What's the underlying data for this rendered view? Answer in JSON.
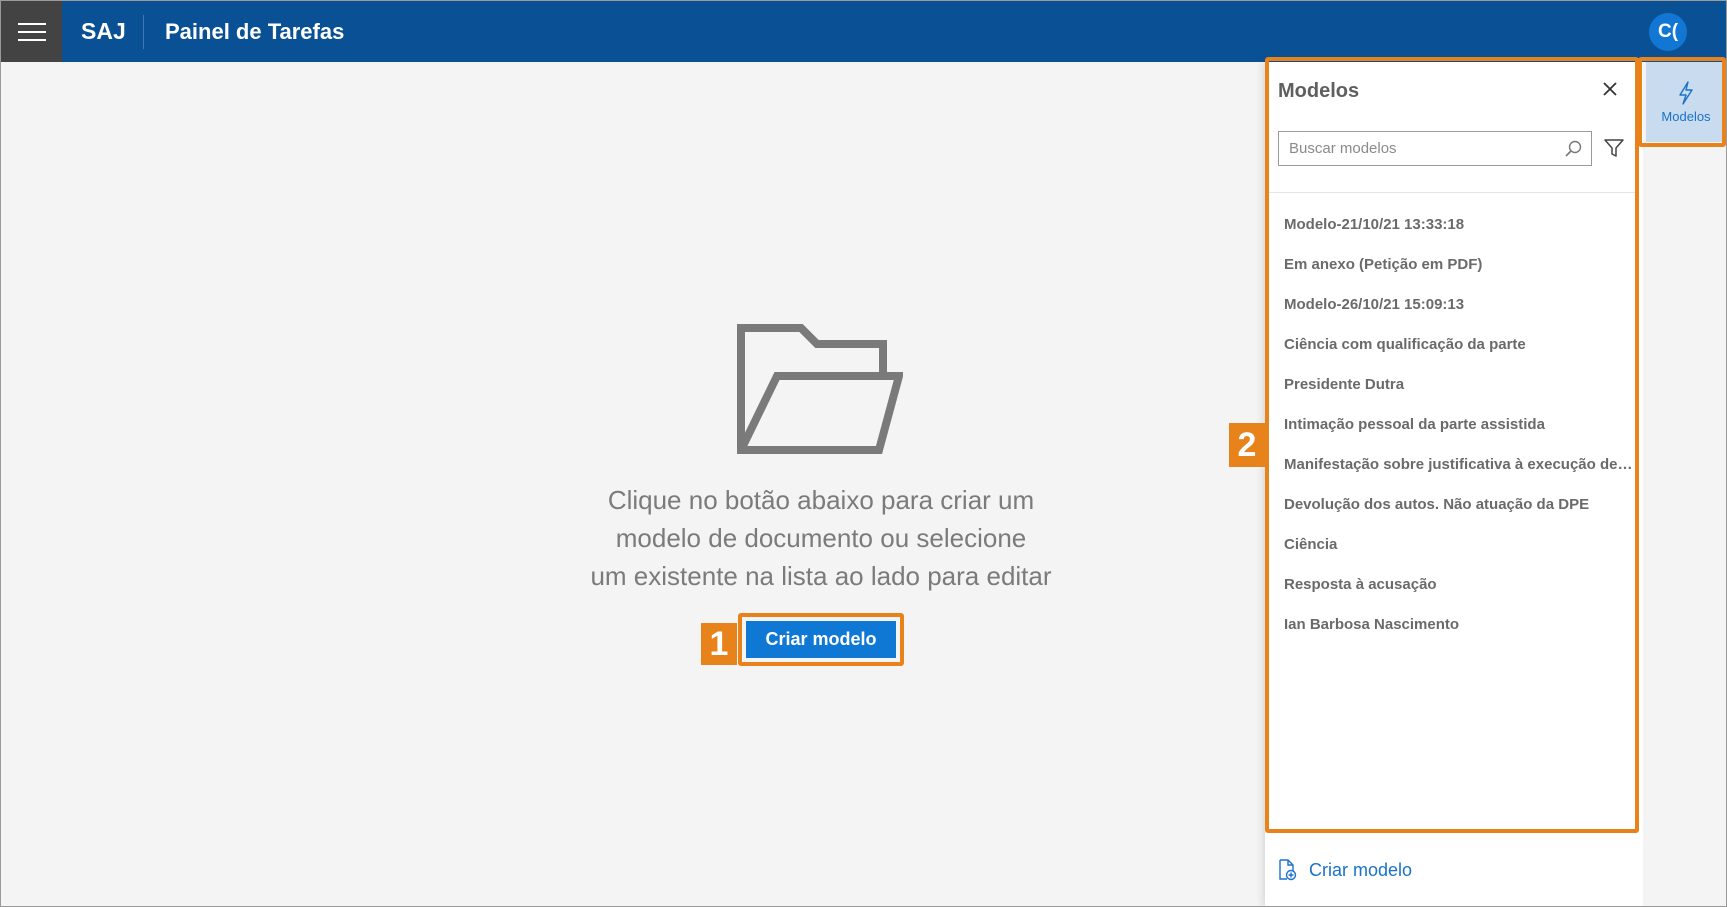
{
  "header": {
    "app_name": "SAJ",
    "page_title": "Painel de Tarefas",
    "avatar_initials": "C("
  },
  "empty_state": {
    "lines": [
      "Clique no botão abaixo para criar um",
      "modelo de documento ou selecione",
      "um existente na lista ao lado para editar"
    ],
    "create_button_label": "Criar modelo"
  },
  "annotations": {
    "badge_1": "1",
    "badge_2": "2",
    "highlight_color": "#e8821a"
  },
  "panel": {
    "title": "Modelos",
    "search_placeholder": "Buscar modelos",
    "items": [
      "Modelo-21/10/21 13:33:18",
      "Em anexo (Petição em PDF)",
      "Modelo-26/10/21 15:09:13",
      "Ciência com qualificação da parte",
      "Presidente Dutra",
      "Intimação pessoal da parte assistida",
      "Manifestação sobre justificativa à execução de alimentos",
      "Devolução dos autos. Não atuação da DPE",
      "Ciência",
      "Resposta à acusação",
      "Ian Barbosa Nascimento"
    ],
    "footer_label": "Criar modelo"
  },
  "rail": {
    "models_label": "Modelos"
  },
  "colors": {
    "header_bg": "#0a5094",
    "primary": "#0f78d4",
    "link": "#1a72c9",
    "accent_orange": "#e8821a"
  },
  "icons": {
    "menu": "hamburger-icon",
    "folder": "folder-open-icon",
    "close": "close-icon",
    "search": "search-icon",
    "filter": "filter-icon",
    "new_document": "new-document-icon",
    "lightning": "lightning-icon"
  }
}
